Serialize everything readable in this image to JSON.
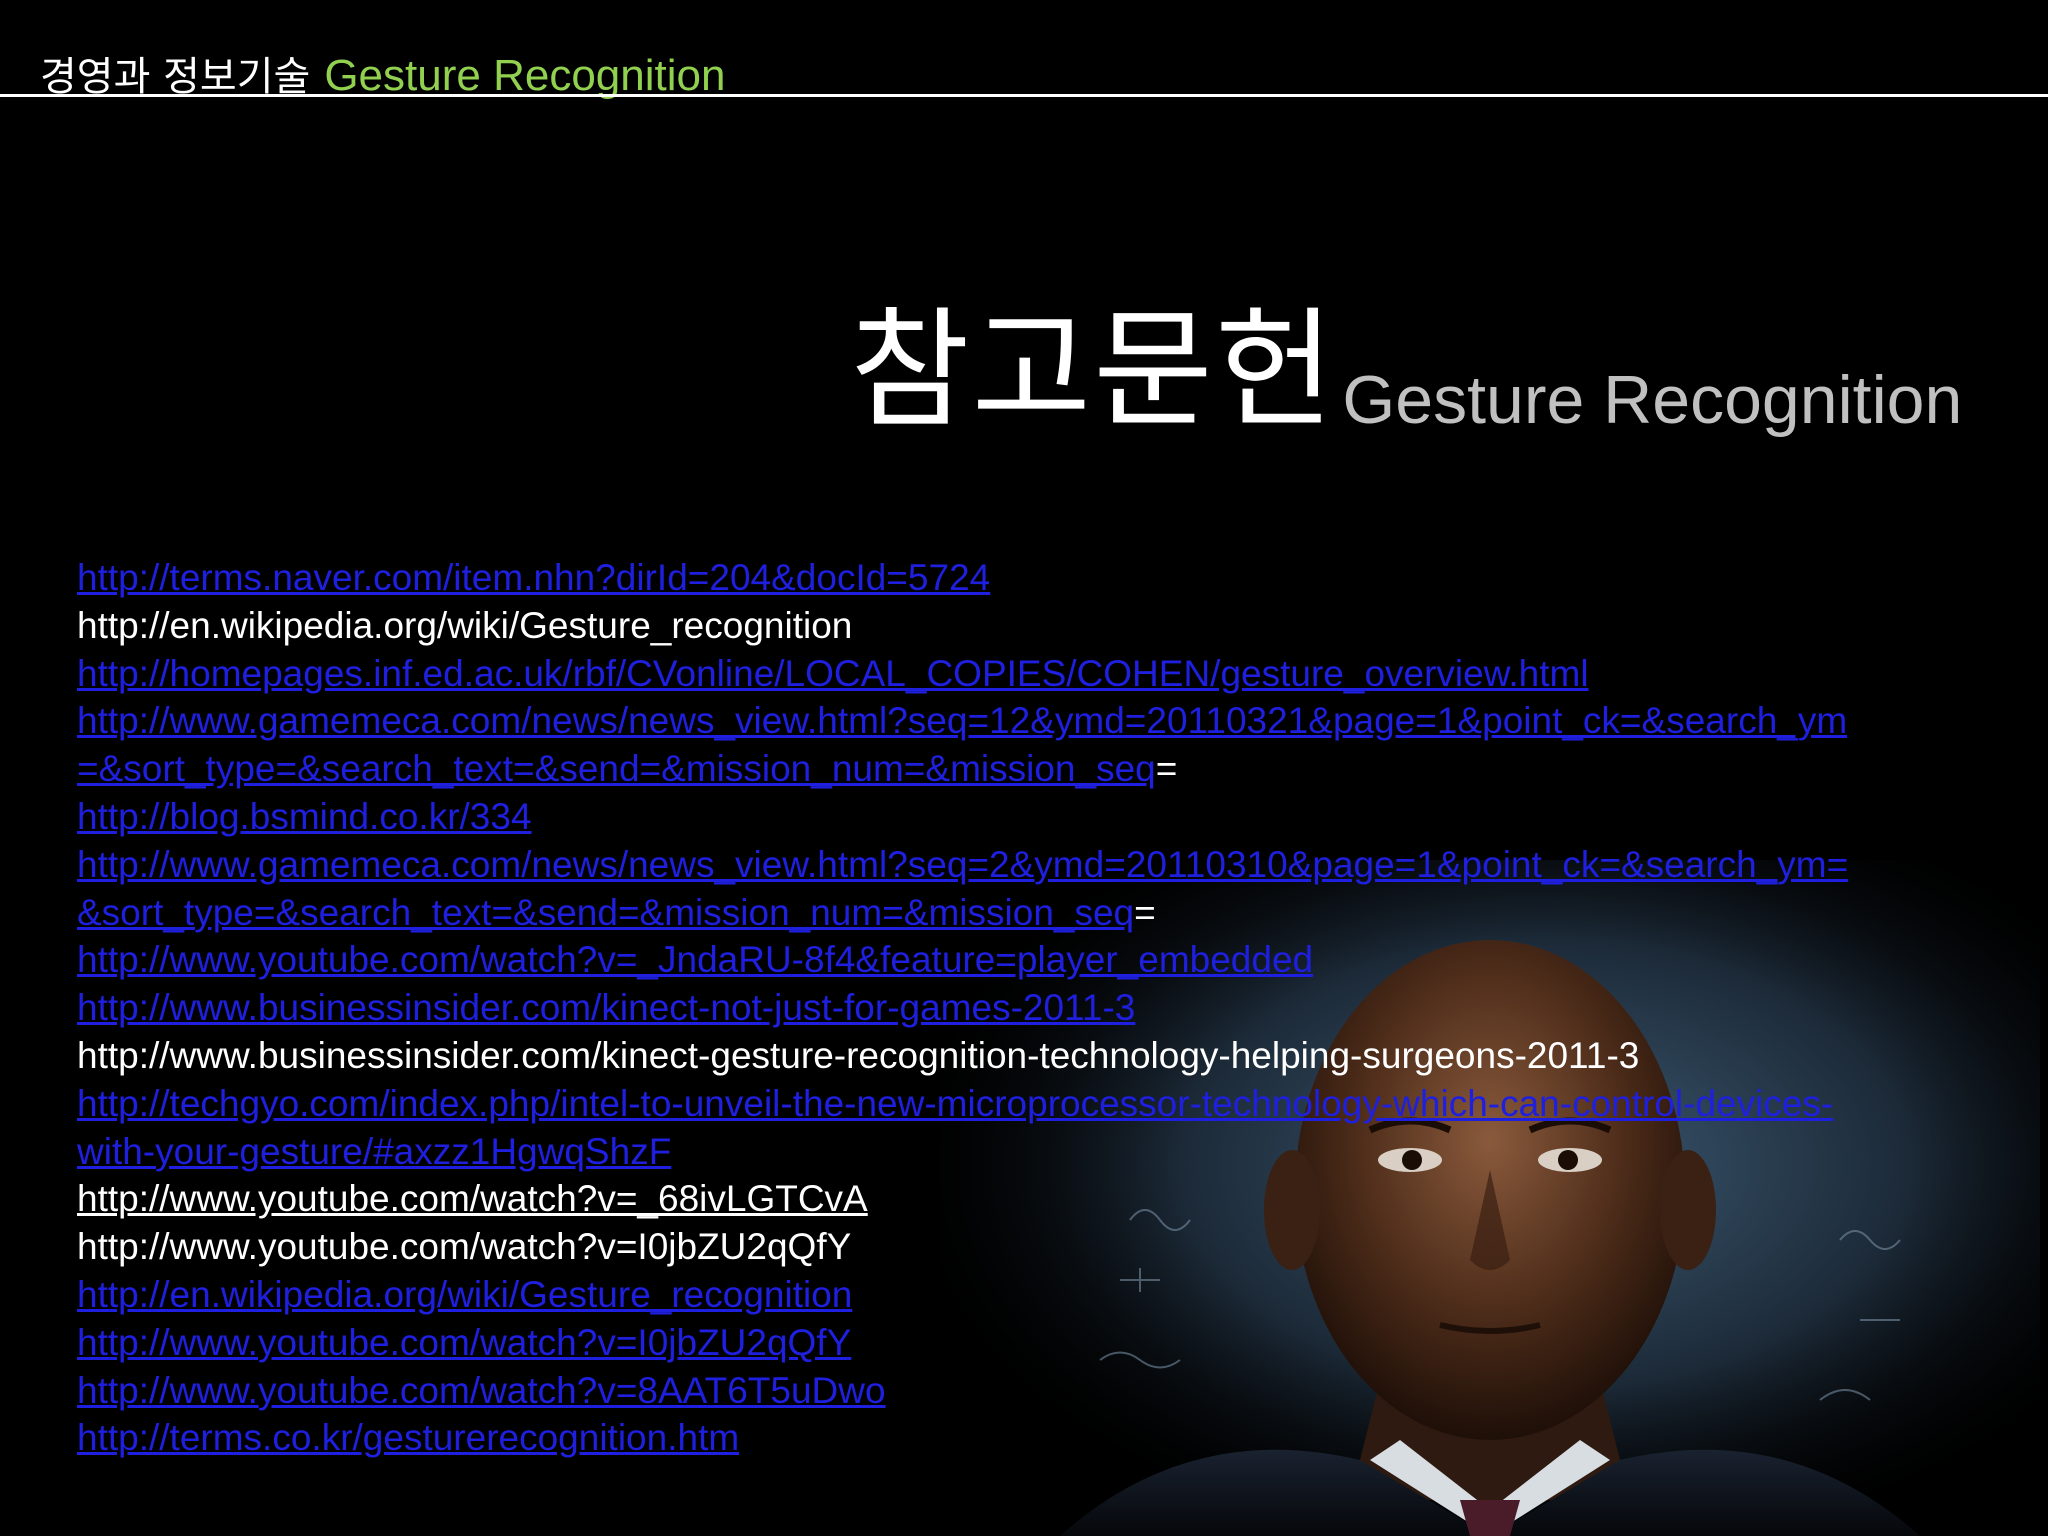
{
  "header": {
    "course": "경영과 정보기술",
    "topic": "Gesture Recognition"
  },
  "title": {
    "korean": "참고문헌",
    "english": "Gesture Recognition"
  },
  "colors": {
    "background": "#000000",
    "header_topic": "#92d050",
    "link": "#1f1fe0",
    "plain_text": "#ffffff",
    "title_english": "#c0c0c0"
  },
  "references": [
    {
      "text": "http://terms.naver.com/item.nhn?dirId=204&docId=5724",
      "style": "link"
    },
    {
      "text": "http://en.wikipedia.org/wiki/Gesture_recognition",
      "style": "plain"
    },
    {
      "text": "http://homepages.inf.ed.ac.uk/rbf/CVonline/LOCAL_COPIES/COHEN/gesture_overview.html",
      "style": "link"
    },
    {
      "text": "http://www.gamemeca.com/news/news_view.html?seq=12&ymd=20110321&page=1&point_ck=&search_ym",
      "style": "link"
    },
    {
      "text": "=&sort_type=&search_text=&send=&mission_num=&mission_seq",
      "style": "link",
      "tail": "="
    },
    {
      "text": "http://blog.bsmind.co.kr/334",
      "style": "link"
    },
    {
      "text": "http://www.gamemeca.com/news/news_view.html?seq=2&ymd=20110310&page=1&point_ck=&search_ym=",
      "style": "link"
    },
    {
      "text": "&sort_type=&search_text=&send=&mission_num=&mission_seq",
      "style": "link",
      "tail": "="
    },
    {
      "text": "http://www.youtube.com/watch?v=_JndaRU-8f4&feature=player_embedded",
      "style": "link"
    },
    {
      "text": "http://www.businessinsider.com/kinect-not-just-for-games-2011-3",
      "style": "link"
    },
    {
      "text": "http://www.businessinsider.com/kinect-gesture-recognition-technology-helping-surgeons-2011-3",
      "style": "plain"
    },
    {
      "text": "http://techgyo.com/index.php/intel-to-unveil-the-new-microprocessor-technology-which-can-control-devices-",
      "style": "link"
    },
    {
      "text": "with-your-gesture/#axzz1HgwqShzF",
      "style": "link"
    },
    {
      "text": "http://www.youtube.com/watch?v=_68ivLGTCvA",
      "style": "plainlink"
    },
    {
      "text": "http://www.youtube.com/watch?v=I0jbZU2qQfY",
      "style": "plain"
    },
    {
      "text": "http://en.wikipedia.org/wiki/Gesture_recognition",
      "style": "link"
    },
    {
      "text": "http://www.youtube.com/watch?v=I0jbZU2qQfY",
      "style": "link"
    },
    {
      "text": "http://www.youtube.com/watch?v=8AAT6T5uDwo",
      "style": "link"
    },
    {
      "text": "http://terms.co.kr/gesturerecognition.htm",
      "style": "link"
    }
  ]
}
